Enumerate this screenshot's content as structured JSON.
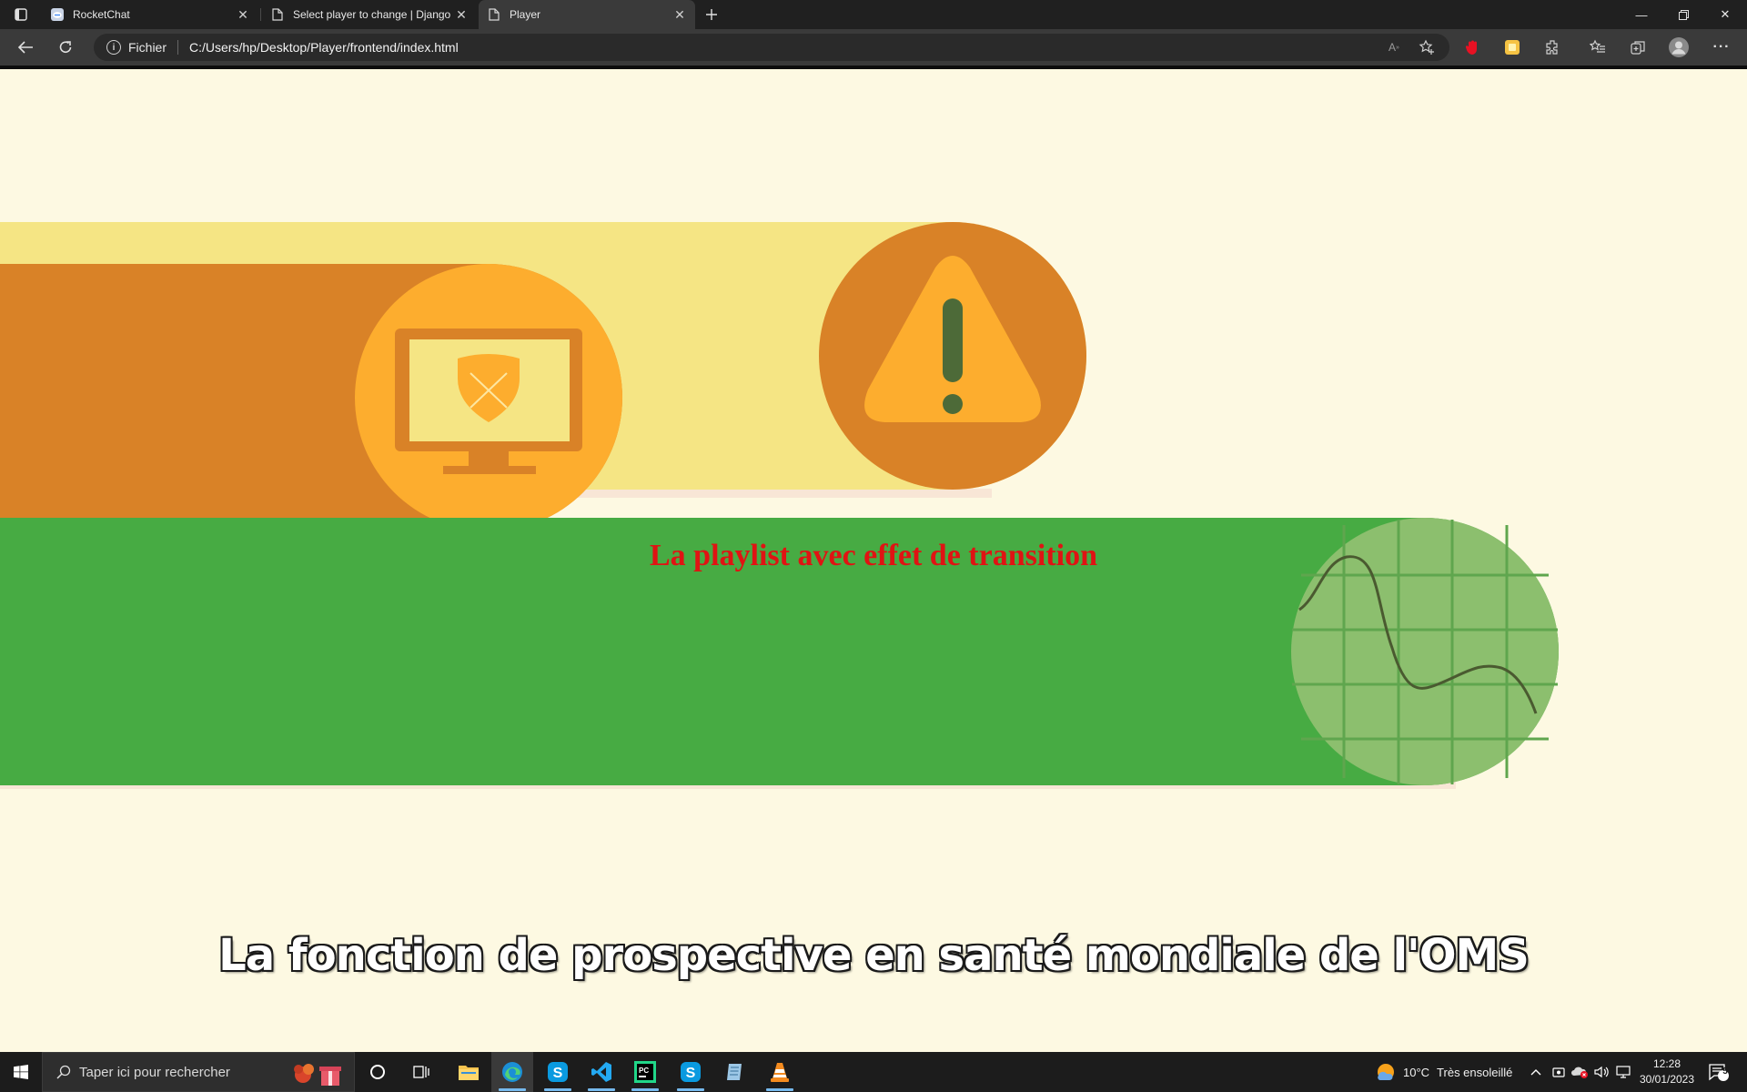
{
  "browser": {
    "tabs": [
      {
        "title": "RocketChat",
        "icon": "rocketchat-icon",
        "active": false
      },
      {
        "title": "Select player to change | Django",
        "icon": "page-icon",
        "active": false
      },
      {
        "title": "Player",
        "icon": "page-icon",
        "active": true
      }
    ],
    "new_tab_icon": "plus-icon",
    "address": {
      "prefix": "Fichier",
      "url": "C:/Users/hp/Desktop/Player/frontend/index.html"
    }
  },
  "page": {
    "heading": "La playlist avec effet de transition",
    "video": {
      "subtitle": "La fonction de prospective en santé mondiale de l'OMS",
      "colors": {
        "background": "#fdf9e2",
        "yellow_band": "#f5e584",
        "orange_band": "#d98227",
        "orange_circle": "#fdad2e",
        "green_band": "#47ab43",
        "green_circle": "#8cbf6e"
      }
    }
  },
  "taskbar": {
    "search_placeholder": "Taper ici pour rechercher",
    "weather": {
      "temp": "10°C",
      "condition": "Très ensoleillé"
    },
    "time": "12:28",
    "date": "30/01/2023",
    "notifications": "5"
  }
}
